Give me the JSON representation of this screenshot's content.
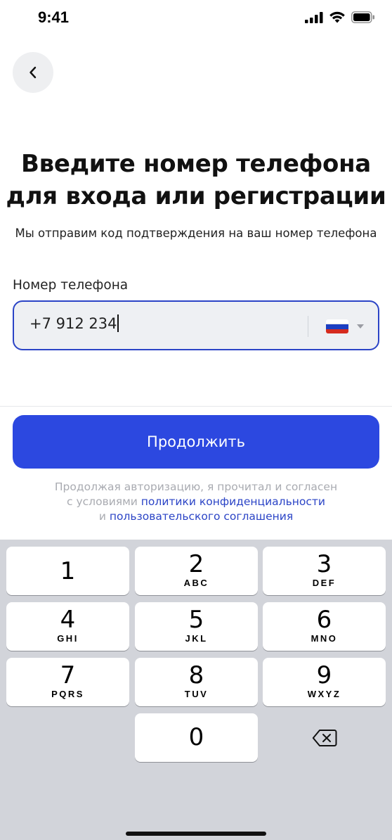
{
  "status_bar": {
    "time": "9:41"
  },
  "header": {
    "back_icon": "chevron-left-icon",
    "title_line1": "Введите номер телефона",
    "title_line2": "для входа или регистрации",
    "subtitle": "Мы отправим код подтверждения на ваш номер телефона"
  },
  "form": {
    "label": "Номер телефона",
    "phone_value": "+7 912 234",
    "country_flag": "russia-flag-icon",
    "active_border_color": "#2b44c6"
  },
  "actions": {
    "continue_label": "Продолжить",
    "continue_color": "#2c48e0"
  },
  "legal": {
    "line1": "Продолжая авторизацию, я прочитал и согласен",
    "line2_prefix": "с условиями ",
    "privacy_link": "политики конфиденциальности",
    "line3_prefix": "и ",
    "terms_link": "пользовательского соглашения",
    "link_color": "#2b44c6"
  },
  "keyboard": {
    "keys": [
      {
        "digit": "1",
        "letters": ""
      },
      {
        "digit": "2",
        "letters": "ABC"
      },
      {
        "digit": "3",
        "letters": "DEF"
      },
      {
        "digit": "4",
        "letters": "GHI"
      },
      {
        "digit": "5",
        "letters": "JKL"
      },
      {
        "digit": "6",
        "letters": "MNO"
      },
      {
        "digit": "7",
        "letters": "PQRS"
      },
      {
        "digit": "8",
        "letters": "TUV"
      },
      {
        "digit": "9",
        "letters": "WXYZ"
      },
      {
        "digit": "0",
        "letters": ""
      }
    ],
    "delete_icon": "backspace-icon"
  }
}
